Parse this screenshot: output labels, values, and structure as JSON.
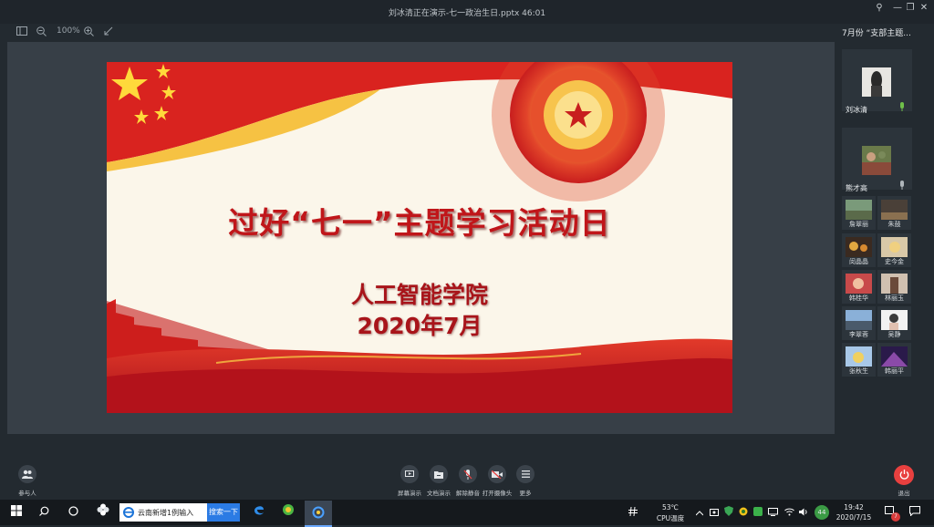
{
  "window": {
    "title": "刘冰清正在演示-七一政治生日.pptx 46:01",
    "controls": {
      "pin": "⚲",
      "minimize": "—",
      "restore": "❐",
      "close": "✕"
    }
  },
  "toolbar": {
    "zoom": "100%"
  },
  "slide": {
    "title": "过好“七一”主题学习活动日",
    "subtitle1": "人工智能学院",
    "subtitle2": "2020年7月"
  },
  "panel": {
    "header": "7月份 “支部主题...",
    "videos": [
      {
        "name": "刘冰清",
        "mic": "active"
      },
      {
        "name": "熊才高",
        "mic": "idle"
      }
    ],
    "participants": [
      "詹翠丽",
      "朱鼓",
      "闵晶晶",
      "史今金",
      "韩桂华",
      "林丽玉",
      "李翠蓉",
      "吴静",
      "张秋生",
      "韩丽平"
    ]
  },
  "controls": {
    "participants": "参与人",
    "items": [
      {
        "label": "屏幕演示",
        "icon": "screen-share-icon"
      },
      {
        "label": "文档演示",
        "icon": "document-icon"
      },
      {
        "label": "解除静音",
        "icon": "mic-off-icon"
      },
      {
        "label": "打开摄像头",
        "icon": "camera-off-icon"
      },
      {
        "label": "更多",
        "icon": "more-icon"
      }
    ],
    "exit": "退出"
  },
  "taskbar": {
    "search_text": "云南新增1例输入",
    "search_button": "搜索一下",
    "temp": "53℃",
    "temp_label": "CPU温度",
    "time": "19:42",
    "date": "2020/7/15",
    "badge_count": "44",
    "notification_count": "7"
  },
  "colors": {
    "accent_red": "#c0161a",
    "mic_green": "#6fbf4a",
    "exit_red": "#e8403f",
    "search_blue": "#2b7be4"
  }
}
